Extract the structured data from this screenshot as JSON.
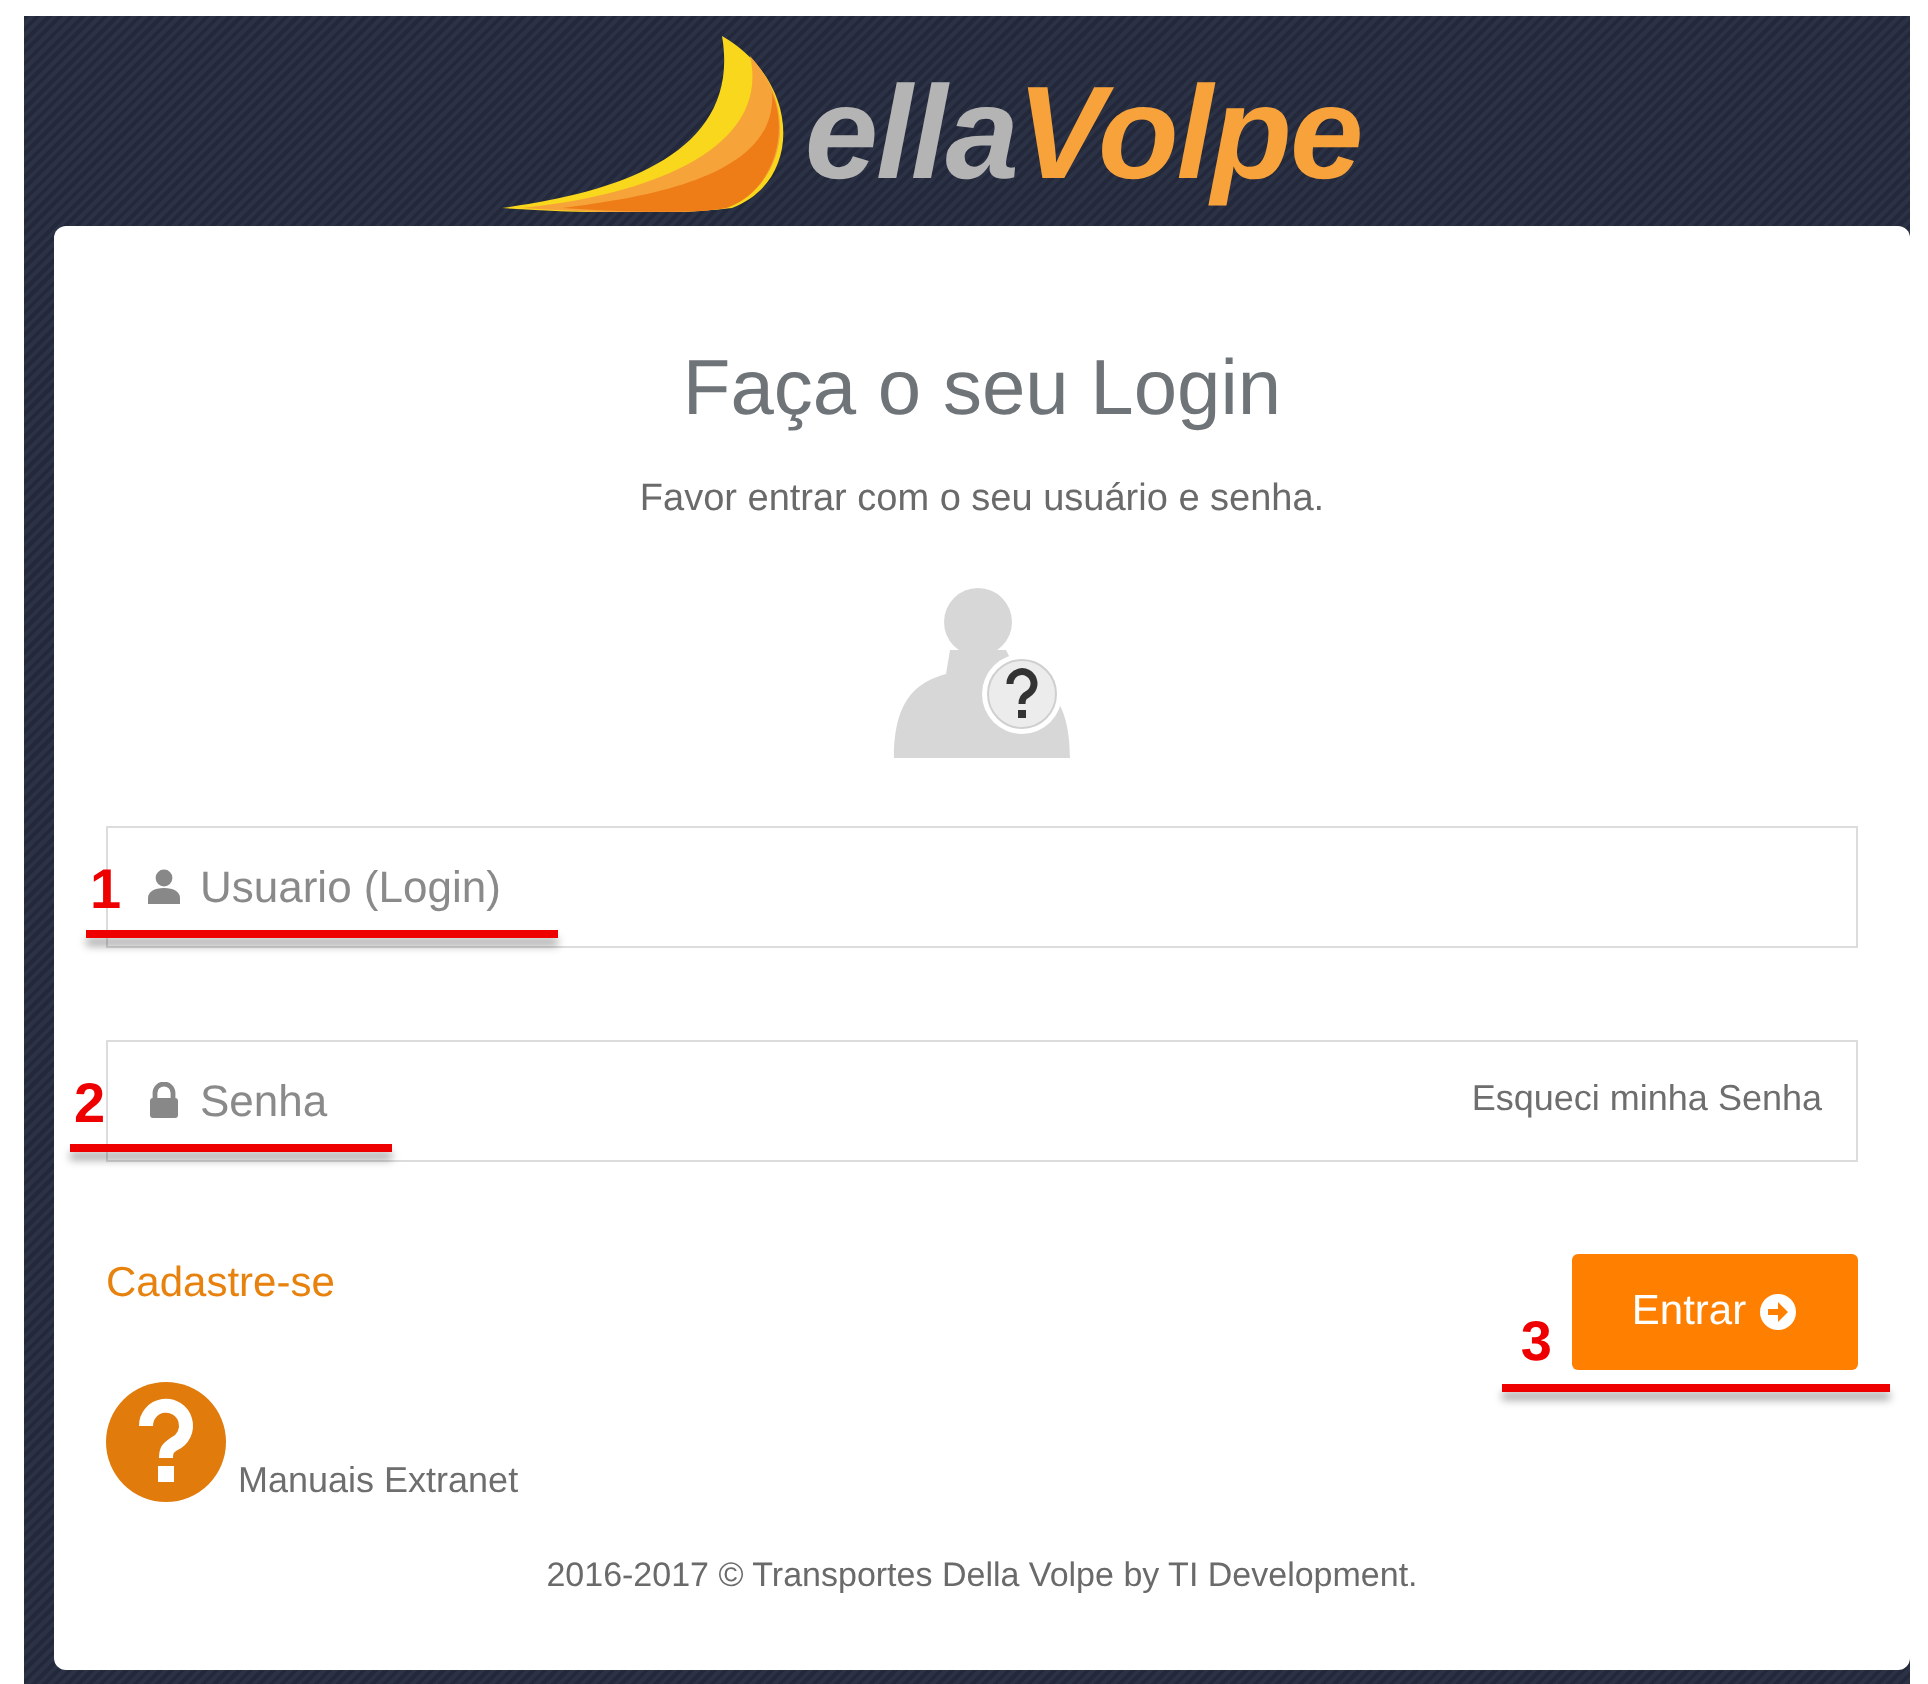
{
  "logo": {
    "text_gray": "ella",
    "text_orange": "Volpe"
  },
  "heading": "Faça o seu Login",
  "subtitle": "Favor entrar com o seu usuário e senha.",
  "fields": [
    {
      "kind": "user",
      "placeholder": "Usuario (Login)",
      "annotation": "1"
    },
    {
      "kind": "password",
      "placeholder": "Senha",
      "link": "Esqueci minha Senha",
      "annotation": "2"
    }
  ],
  "register_link": "Cadastre-se",
  "submit": {
    "label": "Entrar",
    "annotation": "3"
  },
  "help": {
    "label": "Manuais Extranet"
  },
  "footer": "2016-2017 © Transportes Della Volpe by TI Development."
}
